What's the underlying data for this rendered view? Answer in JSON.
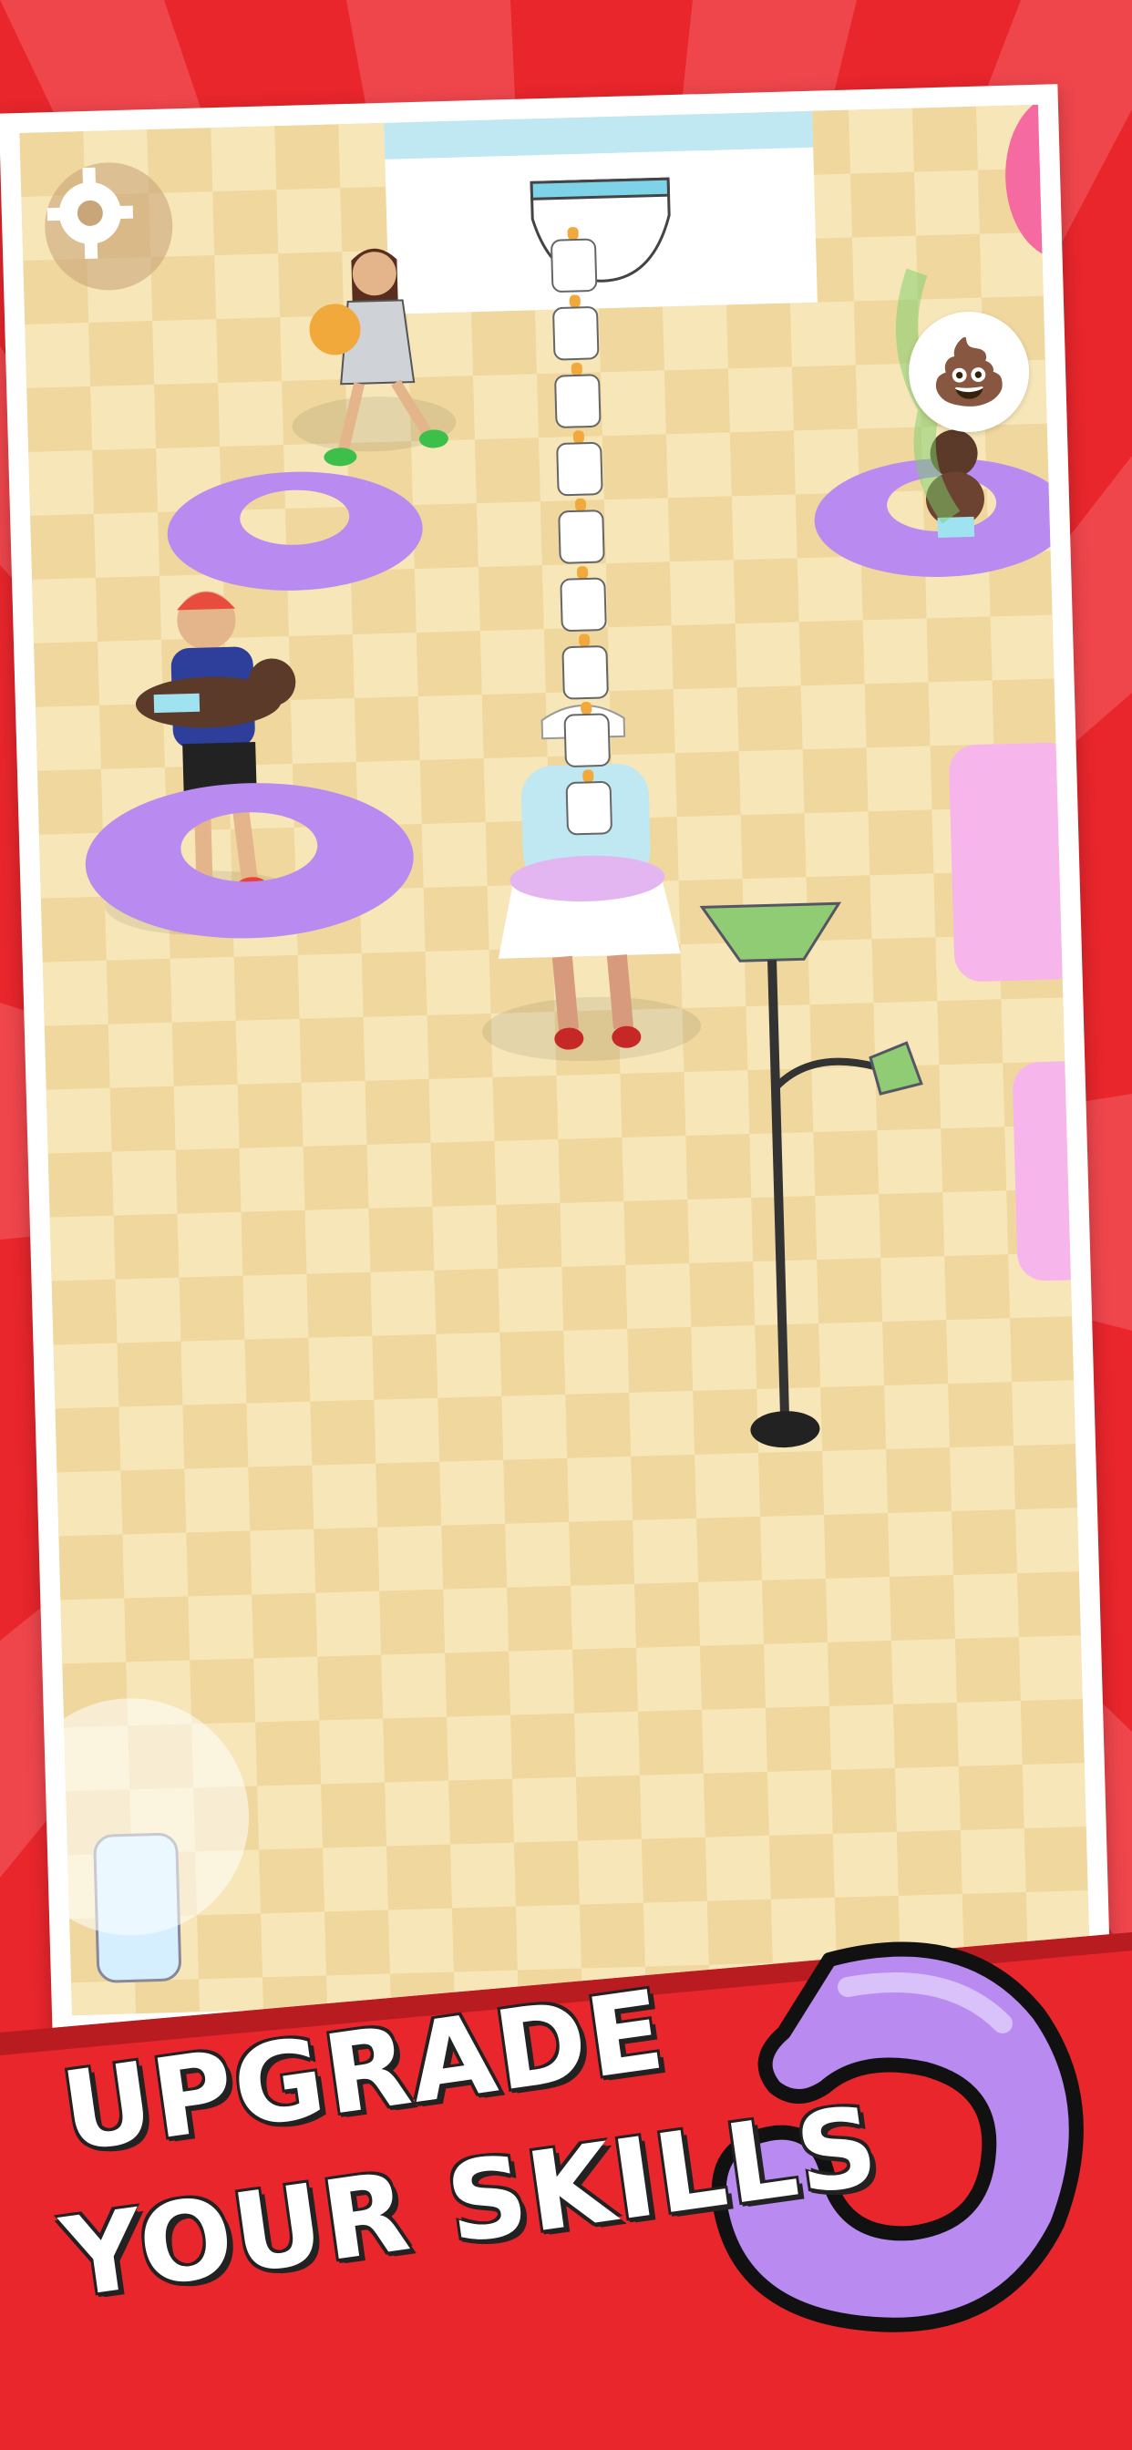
{
  "banner": {
    "line1": "UPGRADE",
    "line2": "YOUR SKILLS"
  },
  "hud": {
    "settings_icon": "gear-icon",
    "poop_icon": "poop-icon",
    "poop_glyph": "💩"
  },
  "colors": {
    "background_red": "#e8262c",
    "floor_tile_light": "#f7e6b8",
    "floor_tile_dark": "#efd79e",
    "pillow_purple": "#b98bf0",
    "banner_text": "#ffffff"
  },
  "scene": {
    "bottle_stack_count": 9
  }
}
